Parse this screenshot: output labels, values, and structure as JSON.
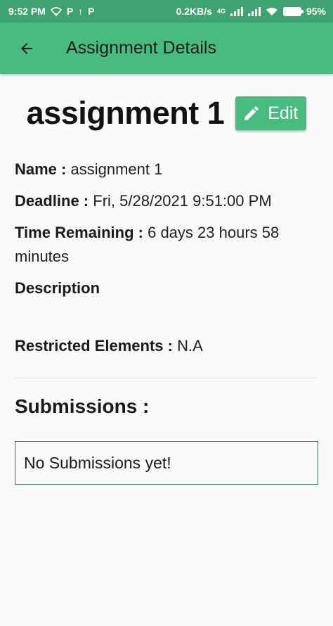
{
  "status_bar": {
    "time": "9:52 PM",
    "left_icons": [
      "wifi-icon",
      "p-icon",
      "upload-icon",
      "p-icon"
    ],
    "speed": "0.2KB/s",
    "network_type": "4G",
    "battery": "95%"
  },
  "app_bar": {
    "back_icon": "arrow-left-icon",
    "title": "Assignment Details",
    "color": "#48bb80"
  },
  "assignment": {
    "title": "assignment 1",
    "edit_label": "Edit",
    "edit_icon": "pencil-icon"
  },
  "details": {
    "name_label": "Name :",
    "name_value": "assignment 1",
    "deadline_label": "Deadline :",
    "deadline_value": "Fri, 5/28/2021 9:51:00 PM",
    "remaining_label": "Time Remaining :",
    "remaining_value": "6 days 23 hours 58 minutes",
    "description_label": "Description",
    "restricted_label": "Restricted Elements :",
    "restricted_value": "N.A"
  },
  "submissions": {
    "heading": "Submissions :",
    "empty_text": "No Submissions yet!"
  }
}
